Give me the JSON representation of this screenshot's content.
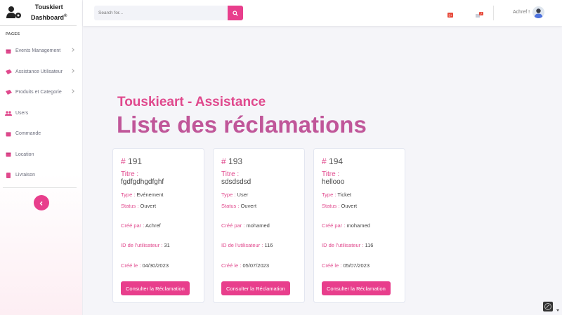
{
  "brand": {
    "line1": "Touskiert",
    "line2": "Dashboard",
    "reg": "®"
  },
  "sidebar": {
    "section": "PAGES",
    "items": [
      {
        "label": "Events Management",
        "icon": "calendar-icon",
        "has_chevron": true
      },
      {
        "label": "Assistance Utilisateur",
        "icon": "ticket-icon",
        "has_chevron": true
      },
      {
        "label": "Produits et Categorie",
        "icon": "ticket-icon",
        "has_chevron": true
      },
      {
        "label": "Users",
        "icon": "users-icon",
        "has_chevron": false
      },
      {
        "label": "Commande",
        "icon": "calendar-icon",
        "has_chevron": false
      },
      {
        "label": "Location",
        "icon": "calendar-icon",
        "has_chevron": false
      },
      {
        "label": "Livraison",
        "icon": "file-icon",
        "has_chevron": false
      }
    ],
    "toggle_icon": "chevron-left-icon"
  },
  "topbar": {
    "search_placeholder": "Search for...",
    "username": "Achref !",
    "alerts_badge": "3+",
    "messages_badge": "7"
  },
  "header": {
    "subtitle": "Touskieart - Assistance",
    "title": "Liste des réclamations"
  },
  "cards": [
    {
      "hash": "#",
      "id": "191",
      "titre_label": "Titre :",
      "titre": "fgdfgdhgdfghf",
      "type_label": "Type :",
      "type": "Evénement",
      "status_label": "Status :",
      "status": "Ouvert",
      "cree_par_label": "Créé par :",
      "cree_par": "Achref",
      "user_id_label": "ID de l'utilisateur :",
      "user_id": "31",
      "cree_le_label": "Créé le :",
      "cree_le": "04/30/2023",
      "button": "Consulter la Réclamation"
    },
    {
      "hash": "#",
      "id": "193",
      "titre_label": "Titre :",
      "titre": "sdsdsdsd",
      "type_label": "Type :",
      "type": "User",
      "status_label": "Status :",
      "status": "Ouvert",
      "cree_par_label": "Créé par :",
      "cree_par": "mohamed",
      "user_id_label": "ID de l'utilisateur :",
      "user_id": "116",
      "cree_le_label": "Créé le :",
      "cree_le": "05/07/2023",
      "button": "Consulter la Réclamation"
    },
    {
      "hash": "#",
      "id": "194",
      "titre_label": "Titre :",
      "titre": "hellooo",
      "type_label": "Type :",
      "type": "Ticket",
      "status_label": "Status :",
      "status": "Ouvert",
      "cree_par_label": "Créé par :",
      "cree_par": "mohamed",
      "user_id_label": "ID de l'utilisateur :",
      "user_id": "116",
      "cree_le_label": "Créé le :",
      "cree_le": "05/07/2023",
      "button": "Consulter la Réclamation"
    }
  ],
  "colors": {
    "accent": "#e83e8c",
    "title": "#c05699",
    "subtitle": "#e0498d"
  }
}
